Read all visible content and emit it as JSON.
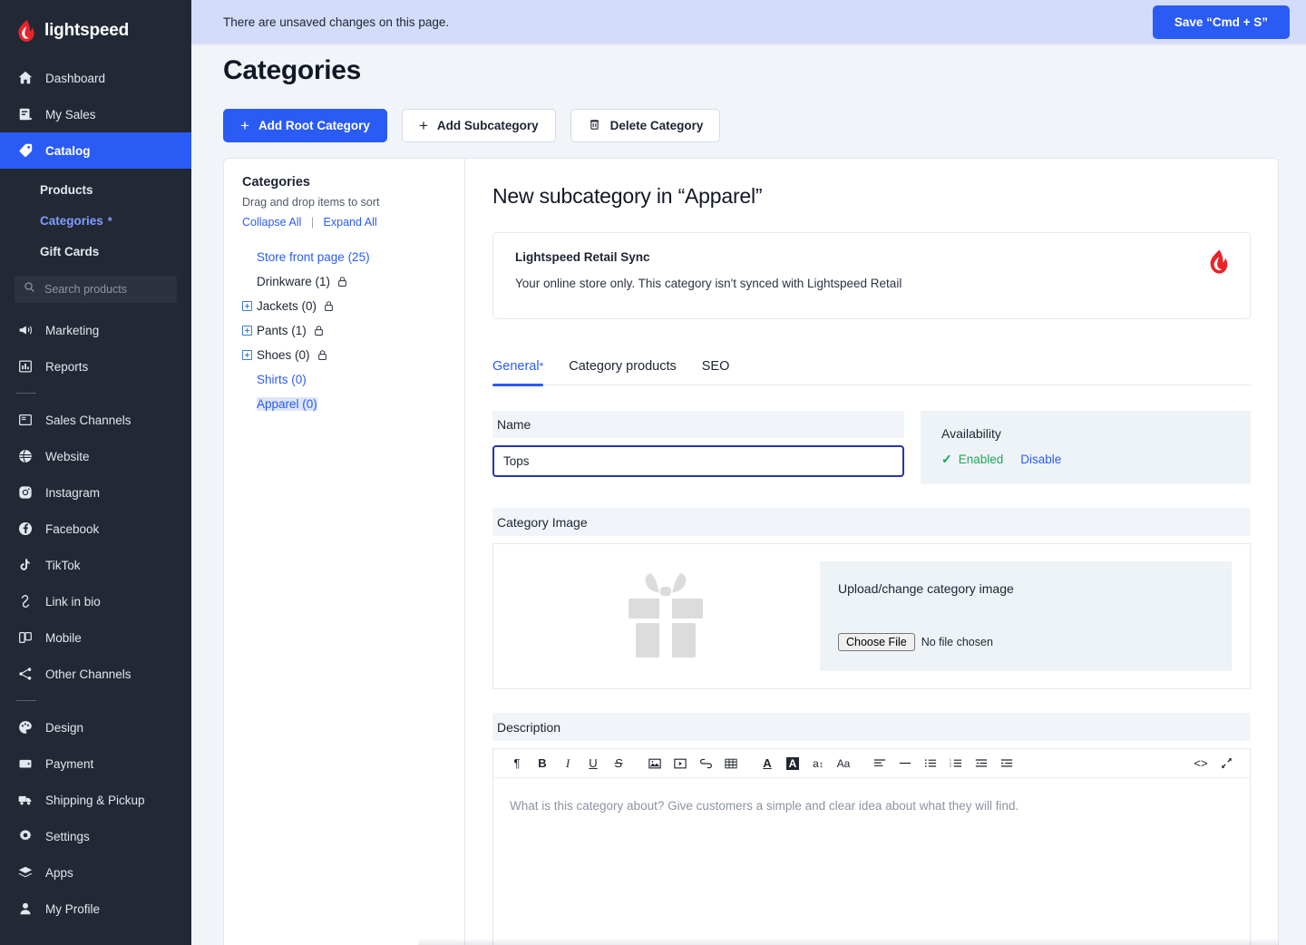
{
  "brand": {
    "name": "lightspeed",
    "logo_icon": "flame-logo-icon",
    "logo_color": "#e8242a"
  },
  "sidebar": {
    "items": [
      {
        "label": "Dashboard",
        "icon": "home-icon",
        "active": false
      },
      {
        "label": "My Sales",
        "icon": "receipt-icon",
        "active": false
      },
      {
        "label": "Catalog",
        "icon": "tag-icon",
        "active": true
      }
    ],
    "sub_items": [
      {
        "label": "Products",
        "selected": false,
        "star": ""
      },
      {
        "label": "Categories",
        "selected": true,
        "star": "*"
      },
      {
        "label": "Gift Cards",
        "selected": false,
        "star": ""
      }
    ],
    "search": {
      "placeholder": "Search products",
      "value": "",
      "icon": "search-icon"
    },
    "group2": [
      {
        "label": "Marketing",
        "icon": "megaphone-icon"
      },
      {
        "label": "Reports",
        "icon": "bar-chart-icon"
      }
    ],
    "group3": [
      {
        "label": "Sales Channels",
        "icon": "storefront-icon"
      },
      {
        "label": "Website",
        "icon": "globe-icon"
      },
      {
        "label": "Instagram",
        "icon": "instagram-icon"
      },
      {
        "label": "Facebook",
        "icon": "facebook-icon"
      },
      {
        "label": "TikTok",
        "icon": "tiktok-icon"
      },
      {
        "label": "Link in bio",
        "icon": "link-icon"
      },
      {
        "label": "Mobile",
        "icon": "mobile-icon"
      },
      {
        "label": "Other Channels",
        "icon": "share-nodes-icon"
      }
    ],
    "group4": [
      {
        "label": "Design",
        "icon": "palette-icon"
      },
      {
        "label": "Payment",
        "icon": "wallet-icon"
      },
      {
        "label": "Shipping & Pickup",
        "icon": "truck-icon"
      },
      {
        "label": "Settings",
        "icon": "gear-icon"
      },
      {
        "label": "Apps",
        "icon": "layers-icon"
      },
      {
        "label": "My Profile",
        "icon": "user-icon"
      }
    ]
  },
  "topbar": {
    "unsaved_message": "There are unsaved changes on this page.",
    "save_label": "Save “Cmd + S”",
    "accent_color": "#2a5bf5",
    "banner_color": "#d3dcfb"
  },
  "page": {
    "title": "Categories"
  },
  "toolbar": {
    "add_root": "Add Root Category",
    "add_sub": "Add Subcategory",
    "delete": "Delete Category",
    "plus_glyph": "+",
    "trash_icon": "trash-icon"
  },
  "tree": {
    "title": "Categories",
    "hint": "Drag and drop items to sort",
    "collapse_all": "Collapse All",
    "expand_all": "Expand All",
    "separator": "|",
    "nodes": [
      {
        "label": "Store front page (25)",
        "expandable": false,
        "locked": false,
        "link": true,
        "selected": false
      },
      {
        "label": "Drinkware (1)",
        "expandable": false,
        "locked": true,
        "link": false,
        "selected": false
      },
      {
        "label": "Jackets (0)",
        "expandable": true,
        "locked": true,
        "link": false,
        "selected": false
      },
      {
        "label": "Pants (1)",
        "expandable": true,
        "locked": true,
        "link": false,
        "selected": false
      },
      {
        "label": "Shoes (0)",
        "expandable": true,
        "locked": true,
        "link": false,
        "selected": false
      },
      {
        "label": "Shirts (0)",
        "expandable": false,
        "locked": false,
        "link": true,
        "selected": false
      },
      {
        "label": "Apparel (0)",
        "expandable": false,
        "locked": false,
        "link": true,
        "selected": true
      }
    ]
  },
  "detail": {
    "title": "New subcategory in “Apparel”",
    "sync": {
      "title": "Lightspeed Retail Sync",
      "description": "Your online store only. This category isn't synced with Lightspeed Retail",
      "logo_icon": "flame-logo-icon"
    },
    "tabs": [
      {
        "label": "General",
        "star": "*",
        "active": true
      },
      {
        "label": "Category products",
        "star": "",
        "active": false
      },
      {
        "label": "SEO",
        "star": "",
        "active": false
      }
    ],
    "name_field": {
      "label": "Name",
      "value": "Tops",
      "placeholder": ""
    },
    "availability": {
      "title": "Availability",
      "check_glyph": "✓",
      "enabled_label": "Enabled",
      "disable_label": "Disable",
      "enabled_color": "#25a65b"
    },
    "category_image": {
      "section_label": "Category Image",
      "placeholder_icon": "gift-icon",
      "upload_label": "Upload/change category image",
      "choose_file_label": "Choose File",
      "no_file_label": "No file chosen"
    },
    "description": {
      "section_label": "Description",
      "placeholder": "What is this category about? Give customers a simple and clear idea about what they will find.",
      "toolbar": [
        {
          "name": "paragraph-icon",
          "glyph": "¶"
        },
        {
          "name": "bold-icon",
          "glyph": "B"
        },
        {
          "name": "italic-icon",
          "glyph": "I"
        },
        {
          "name": "underline-icon",
          "glyph": "U"
        },
        {
          "name": "strikethrough-icon",
          "glyph": "S"
        },
        {
          "name": "image-icon",
          "glyph": "▣"
        },
        {
          "name": "video-icon",
          "glyph": "▶"
        },
        {
          "name": "link-icon",
          "glyph": "∞"
        },
        {
          "name": "table-icon",
          "glyph": "▦"
        },
        {
          "name": "text-color-icon",
          "glyph": "A"
        },
        {
          "name": "highlight-color-icon",
          "glyph": "A"
        },
        {
          "name": "font-size-icon",
          "glyph": "a"
        },
        {
          "name": "font-family-icon",
          "glyph": "Aa"
        },
        {
          "name": "align-icon",
          "glyph": "≡"
        },
        {
          "name": "horizontal-rule-icon",
          "glyph": "—"
        },
        {
          "name": "bullet-list-icon",
          "glyph": "☰"
        },
        {
          "name": "numbered-list-icon",
          "glyph": "☰"
        },
        {
          "name": "outdent-icon",
          "glyph": "⇤"
        },
        {
          "name": "indent-icon",
          "glyph": "⇥"
        },
        {
          "name": "source-code-icon",
          "glyph": "<>"
        },
        {
          "name": "fullscreen-icon",
          "glyph": "⤡"
        }
      ]
    }
  }
}
